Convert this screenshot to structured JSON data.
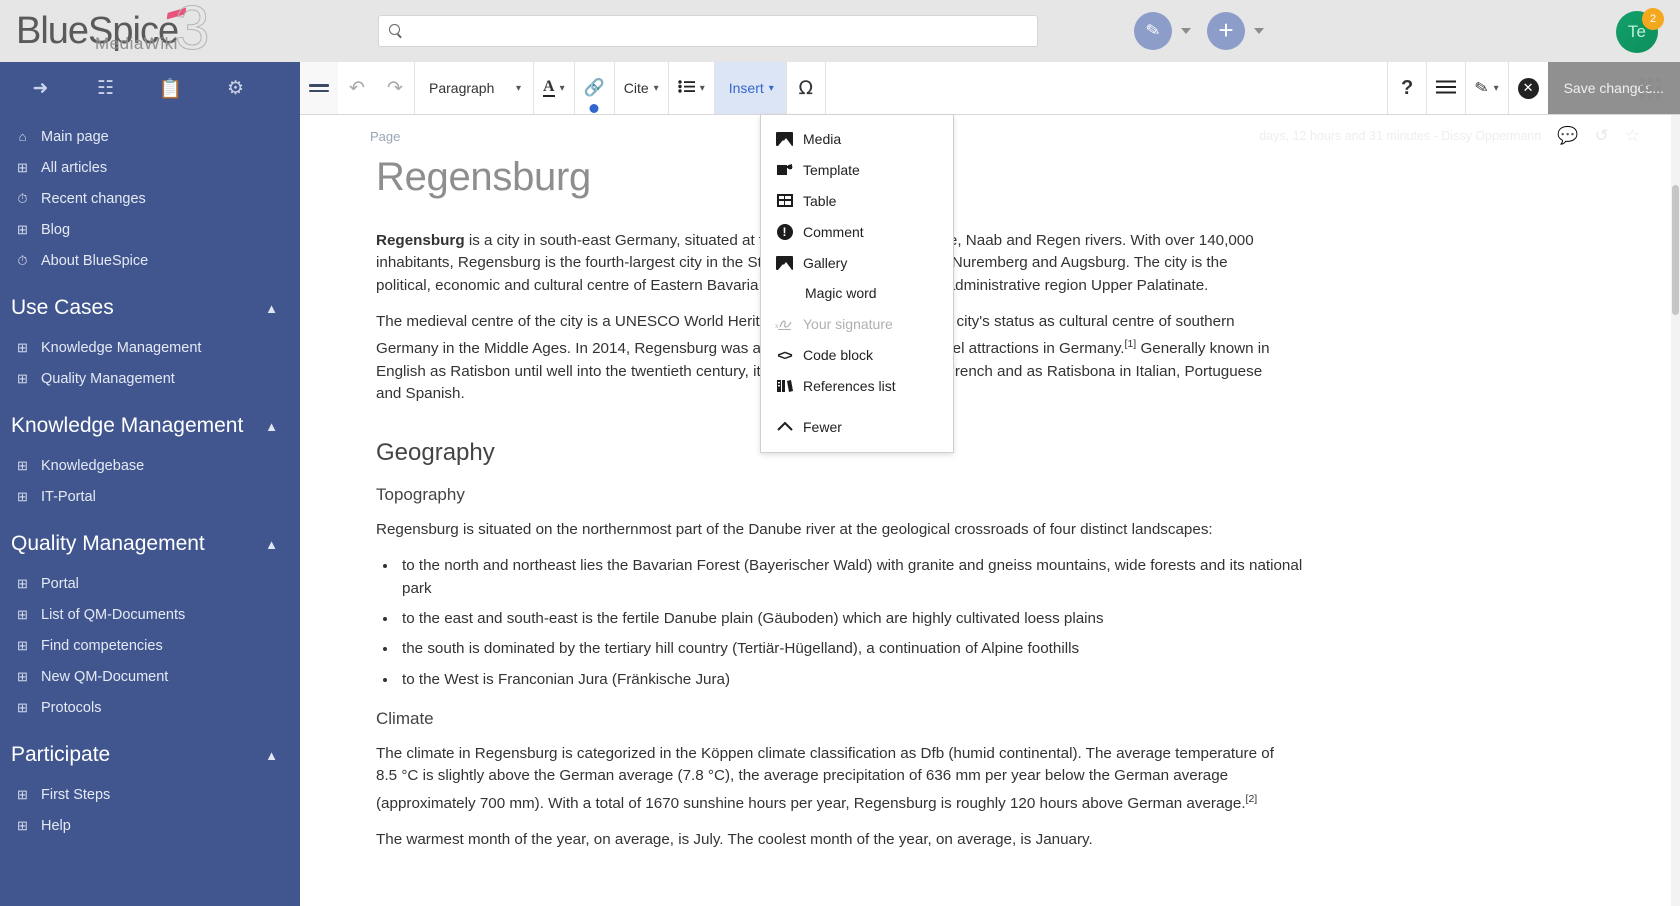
{
  "header": {
    "logo_main": "BlueSpice",
    "logo_sub": "MediaWiki",
    "logo_version": "3",
    "search_placeholder": "",
    "search_value": "",
    "edit_button_icon": "pencil-icon",
    "add_button_icon": "plus-icon",
    "avatar_initials": "Te",
    "avatar_badge": "2",
    "brand_color": "#41568e",
    "accent_color": "#e8547c"
  },
  "sidebar": {
    "icons": [
      "rocket-icon",
      "book-icon",
      "clipboard-icon",
      "gear-icon"
    ],
    "items": [
      {
        "label": "Main page",
        "icon": "home-icon"
      },
      {
        "label": "All articles",
        "icon": "document-icon"
      },
      {
        "label": "Recent changes",
        "icon": "clock-icon"
      },
      {
        "label": "Blog",
        "icon": "document-icon"
      },
      {
        "label": "About BlueSpice",
        "icon": "info-clock-icon"
      }
    ],
    "sections": [
      {
        "title": "Use Cases",
        "collapse_icon": "chevron-up-icon",
        "items": [
          {
            "label": "Knowledge Management",
            "icon": "document-icon"
          },
          {
            "label": "Quality Management",
            "icon": "document-icon"
          }
        ]
      },
      {
        "title": "Knowledge Management",
        "collapse_icon": "chevron-up-icon",
        "items": [
          {
            "label": "Knowledgebase",
            "icon": "document-icon"
          },
          {
            "label": "IT-Portal",
            "icon": "document-icon"
          }
        ]
      },
      {
        "title": "Quality Management",
        "collapse_icon": "chevron-up-icon",
        "items": [
          {
            "label": "Portal",
            "icon": "document-icon"
          },
          {
            "label": "List of QM-Documents",
            "icon": "document-icon"
          },
          {
            "label": "Find competencies",
            "icon": "document-icon"
          },
          {
            "label": "New QM-Document",
            "icon": "document-icon"
          },
          {
            "label": "Protocols",
            "icon": "document-icon"
          }
        ]
      },
      {
        "title": "Participate",
        "collapse_icon": "chevron-up-icon",
        "items": [
          {
            "label": "First Steps",
            "icon": "document-icon"
          },
          {
            "label": "Help",
            "icon": "document-icon"
          }
        ]
      }
    ]
  },
  "toolbar": {
    "menu_icon": "hamburger-icon",
    "undo_label": "↶",
    "redo_label": "↷",
    "paragraph_label": "Paragraph",
    "text_style_label": "A",
    "link_label": "🔗",
    "cite_label": "Cite",
    "list_label": "list-icon",
    "insert_label": "Insert",
    "special_char_label": "Ω",
    "help_label": "?",
    "page_options_label": "options-icon",
    "edit_mode_label": "pencil-icon",
    "cancel_label": "✕",
    "save_label": "Save changes...",
    "apps_label": "apps-grid-icon",
    "caret": "⌄"
  },
  "insert_menu": {
    "items": [
      {
        "label": "Media",
        "icon": "media-icon",
        "disabled": false
      },
      {
        "label": "Template",
        "icon": "template-icon",
        "disabled": false
      },
      {
        "label": "Table",
        "icon": "table-icon",
        "disabled": false
      },
      {
        "label": "Comment",
        "icon": "comment-icon",
        "disabled": false
      },
      {
        "label": "Gallery",
        "icon": "gallery-icon",
        "disabled": false
      },
      {
        "label": "Magic word",
        "icon": "",
        "disabled": false
      },
      {
        "label": "Your signature",
        "icon": "signature-icon",
        "disabled": true
      },
      {
        "label": "Code block",
        "icon": "code-icon",
        "disabled": false
      },
      {
        "label": "References list",
        "icon": "references-icon",
        "disabled": false
      },
      {
        "label": "Fewer",
        "icon": "chevron-up-icon",
        "disabled": false
      }
    ]
  },
  "page_info": {
    "breadcrumb": "Page",
    "last_edited": "days, 12 hours and 31 minutes - Dissy Oppermann",
    "discussion_icon": "discussion-icon",
    "history_icon": "history-icon",
    "watch_icon": "star-icon"
  },
  "article": {
    "title": "Regensburg",
    "paragraph_1_lead": "Regensburg",
    "paragraph_1": " is a city in south-east Germany, situated at the confluence of the Danube, Naab and Regen rivers. With over 140,000 inhabitants, Regensburg is the fourth-largest city in the State of Bavaria after Munich, Nuremberg and Augsburg. The city is the political, economic and cultural centre of Eastern Bavaria and capital of the Bavarian administrative region Upper Palatinate.",
    "paragraph_2_part1": "The medieval centre of the city is a UNESCO World Heritage Site in recognition of the city's status as cultural centre of southern Germany in the Middle Ages. In 2014, Regensburg was among the top sights and travel attractions in Germany.",
    "paragraph_2_ref1": "[1]",
    "paragraph_2_part2": " Generally known in English as Ratisbon until well into the twentieth century, it is known as Ratisbonne in French and as Ratisbona in Italian, Portuguese and Spanish.",
    "heading_geography": "Geography",
    "heading_topography": "Topography",
    "topography_intro": "Regensburg is situated on the northernmost part of the Danube river at the geological crossroads of four distinct landscapes:",
    "topography_bullets": [
      "to the north and northeast lies the Bavarian Forest (Bayerischer Wald) with granite and gneiss mountains, wide forests and its national park",
      "to the east and south-east is the fertile Danube plain (Gäuboden) which are highly cultivated loess plains",
      "the south is dominated by the tertiary hill country (Tertiär-Hügelland), a continuation of Alpine foothills",
      "to the West is Franconian Jura (Fränkische Jura)"
    ],
    "heading_climate": "Climate",
    "climate_part1": "The climate in Regensburg is categorized in the Köppen climate classification as Dfb (humid continental). The average temperature of 8.5 °C is slightly above the German average (7.8 °C), the average precipitation of 636 mm per year below the German average (approximately 700 mm). With a total of 1670 sunshine hours per year, Regensburg is roughly 120 hours above German average.",
    "climate_ref2": "[2]",
    "climate_part2": "The warmest month of the year, on average, is July. The coolest month of the year, on average, is January."
  }
}
